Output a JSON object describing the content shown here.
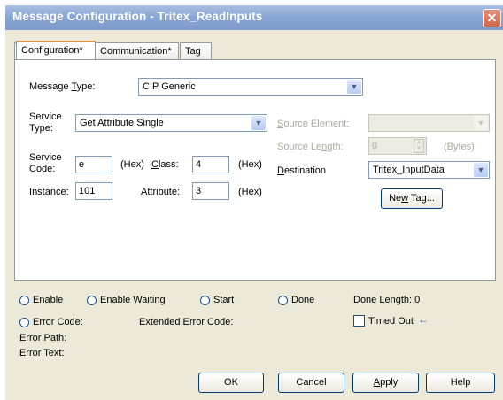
{
  "window": {
    "title": "Message Configuration - Tritex_ReadInputs",
    "close_glyph": "✕"
  },
  "tabs": [
    {
      "label": "Configuration*"
    },
    {
      "label": "Communication*"
    },
    {
      "label": "Tag"
    }
  ],
  "config": {
    "message_type_label": "Message Type:",
    "message_type_value": "CIP Generic",
    "service_type_label": "Service Type:",
    "service_type_value": "Get Attribute Single",
    "service_code_label": "Service Code:",
    "service_code_value": "e",
    "hex_label": "(Hex)",
    "class_label": "Class:",
    "class_value": "4",
    "instance_label": "Instance:",
    "instance_value": "101",
    "attribute_label": "Attribute:",
    "attribute_value": "3",
    "source_element_label": "Source Element:",
    "source_element_value": "",
    "source_length_label": "Source Length:",
    "source_length_value": "0",
    "bytes_label": "(Bytes)",
    "destination_label": "Destination",
    "destination_value": "Tritex_InputData",
    "new_tag_label": "New Tag..."
  },
  "status": {
    "enable": "Enable",
    "enable_waiting": "Enable Waiting",
    "start": "Start",
    "done": "Done",
    "done_length": "Done Length: 0",
    "error_code": "Error Code:",
    "extended_error_code": "Extended Error Code:",
    "timed_out": "Timed Out",
    "timed_out_arrow": "←",
    "error_path": "Error Path:",
    "error_text": "Error Text:"
  },
  "buttons": {
    "ok": "OK",
    "cancel": "Cancel",
    "apply": "Apply",
    "help": "Help"
  },
  "colors": {
    "accent_arrow": "#2255cc",
    "active_tab_border": "#e68b2c"
  }
}
